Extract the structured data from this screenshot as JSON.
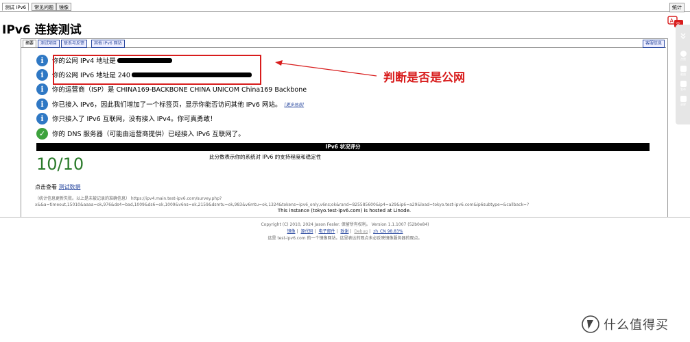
{
  "top_tabs": [
    "测试 IPv6",
    "常见问题",
    "镜像"
  ],
  "stats_button": "统计",
  "page_title": "IPv6 连接测试",
  "panel_tabs": [
    "摘要",
    "测试项目",
    "联系与反馈",
    "其他 IPv6 网站"
  ],
  "contact_button": "客服信息",
  "results": [
    {
      "icon": "info-icon",
      "text": "你的公网 IPv4 地址是",
      "redacted": true
    },
    {
      "icon": "info-icon",
      "text": "你的公网 IPv6 地址是 240",
      "redacted": true
    },
    {
      "icon": "info-icon",
      "text": "你的运营商（ISP）是 CHINA169-BACKBONE CHINA UNICOM China169 Backbone",
      "redacted": false
    },
    {
      "icon": "info-icon",
      "text": "你已接入 IPv6，因此我们增加了一个标签页，显示你能否访问其他 IPv6 网站。",
      "link": "[更多信息]",
      "redacted": false
    },
    {
      "icon": "info-icon",
      "text": "你只接入了 IPv6 互联网，没有接入 IPv4。你可真勇敢！",
      "redacted": false
    },
    {
      "icon": "check-icon",
      "text": "你的 DNS 服务器（可能由运营商提供）已经接入 IPv6 互联网了。",
      "redacted": false
    }
  ],
  "annotation": "判断是否是公网",
  "score_bar_title": "IPv6 状况评分",
  "score": "10/10",
  "score_desc": "此分数表示你的系统对 IPv6 的支持程度和稳定性",
  "view_data_prefix": "点击查看",
  "view_data_link": "测试数据",
  "note_line1": "（统计信息更新失败。以上是未被记录的准确信息）  https://ipv4.main.test-ipv6.com/survey.php?",
  "note_line2": "x&&a=timeout,15010&aaaa=ok,976&ds4=bad,1009&ds6=ok,1009&v6ns=ok,2159&dsmtu=ok,983&v6mtu=ok,1324&tokens=ipv6_only,v6ns;ok&rand=825585600&ip4=a29&ip6=a29&load=tokyo.test-ipv6.com&ip6subtype=&callback=?",
  "hosted": "This instance (tokyo.test-ipv6.com) is hosted at Linode.",
  "copyright": "Copyright (C) 2010, 2024 Jason Fesler. 保留所有权利。 Version 1.1.1007 (52b0e84)",
  "footer_links": [
    "镜像",
    "源代码",
    "电子邮件",
    "致谢",
    "Debug",
    "zh_CN 98.83%"
  ],
  "mirror_note": "这是 test-ipv6.com 的一个镜像网站。这里表达的观点未必反映镜像服务器的观点。",
  "sidebar_items": [
    "",
    "点赞",
    "截图",
    "发布",
    "录屏"
  ],
  "watermark": "什么值得买",
  "colors": {
    "link": "#2b4aa0",
    "annotation": "#d81c1c",
    "score": "#2a7a2a",
    "info": "#2f78c4",
    "ok": "#3da23d"
  }
}
